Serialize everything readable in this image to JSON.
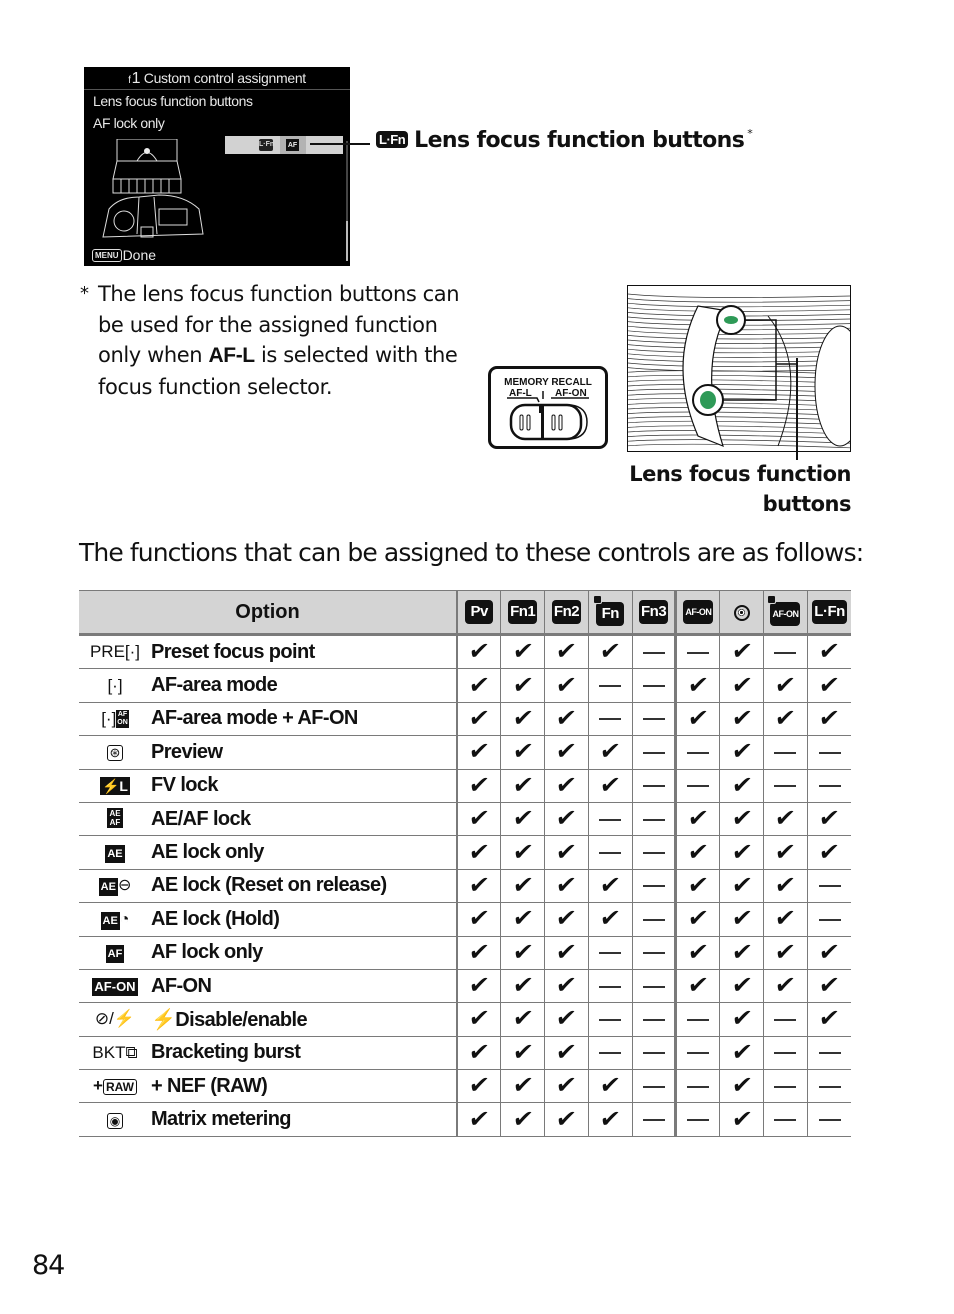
{
  "camera_screen": {
    "menu_code": "f",
    "menu_number": "1",
    "title": "Custom control assignment",
    "selected_control": "Lens focus function buttons",
    "selected_value": "AF lock only",
    "selection_icons": [
      "L·Fn",
      "AF"
    ],
    "done_key": "MENU",
    "done_label": "Done"
  },
  "callout": {
    "badge": "L·Fn",
    "label": "Lens focus function buttons",
    "footnote_marker": "*"
  },
  "footnote": {
    "marker": "*",
    "text_before": "The lens focus function buttons can be used for the assigned function only when ",
    "bold": "AF-L",
    "text_after": " is selected with the focus function selector."
  },
  "selector": {
    "title": "MEMORY RECALL",
    "left_label": "AF-L",
    "right_label": "AF-ON"
  },
  "lens_label": {
    "line1": "Lens focus function",
    "line2": "buttons"
  },
  "intro": "The functions that can be assigned to these controls are as follows:",
  "table": {
    "option_header": "Option",
    "controls": [
      {
        "id": "pv",
        "label": "Pv",
        "style": "badge"
      },
      {
        "id": "fn1",
        "label": "Fn1",
        "style": "badge"
      },
      {
        "id": "fn2",
        "label": "Fn2",
        "style": "badge"
      },
      {
        "id": "vertical-fn",
        "label": "Fn",
        "style": "sub-badge"
      },
      {
        "id": "fn3",
        "label": "Fn3",
        "style": "badge"
      },
      {
        "id": "af-on",
        "label": "AF-ON",
        "style": "small-badge"
      },
      {
        "id": "sub-selector-center",
        "label": "",
        "style": "ring"
      },
      {
        "id": "vertical-af-on",
        "label": "AF-ON",
        "style": "sub-small-badge"
      },
      {
        "id": "l-fn",
        "label": "L·Fn",
        "style": "badge"
      }
    ],
    "rows": [
      {
        "icon": "PRE[·]",
        "icon_name": "preset-focus-point-icon",
        "label": "Preset focus point",
        "values": [
          true,
          true,
          true,
          true,
          false,
          false,
          true,
          false,
          true
        ]
      },
      {
        "icon": "[·]",
        "icon_name": "af-area-mode-icon",
        "label": "AF-area mode",
        "values": [
          true,
          true,
          true,
          false,
          false,
          true,
          true,
          true,
          true
        ]
      },
      {
        "icon": "[·]AF-ON",
        "icon_name": "af-area-mode-af-on-icon",
        "label": "AF-area mode + AF-ON",
        "values": [
          true,
          true,
          true,
          false,
          false,
          true,
          true,
          true,
          true
        ]
      },
      {
        "icon": "preview",
        "icon_name": "preview-aperture-icon",
        "label": "Preview",
        "values": [
          true,
          true,
          true,
          true,
          false,
          false,
          true,
          false,
          false
        ]
      },
      {
        "icon": "⚡L",
        "icon_name": "fv-lock-icon",
        "label": "FV lock",
        "values": [
          true,
          true,
          true,
          true,
          false,
          false,
          true,
          false,
          false
        ]
      },
      {
        "icon": "AE/AF",
        "icon_name": "ae-af-lock-icon",
        "label": "AE/AF lock",
        "values": [
          true,
          true,
          true,
          false,
          false,
          true,
          true,
          true,
          true
        ]
      },
      {
        "icon": "AE",
        "icon_name": "ae-lock-icon",
        "label": "AE lock only",
        "values": [
          true,
          true,
          true,
          false,
          false,
          true,
          true,
          true,
          true
        ]
      },
      {
        "icon": "AE⊖",
        "icon_name": "ae-lock-reset-icon",
        "label": "AE lock (Reset on release)",
        "values": [
          true,
          true,
          true,
          true,
          false,
          true,
          true,
          true,
          false
        ]
      },
      {
        "icon": "AE◔",
        "icon_name": "ae-lock-hold-icon",
        "label": "AE lock (Hold)",
        "values": [
          true,
          true,
          true,
          true,
          false,
          true,
          true,
          true,
          false
        ]
      },
      {
        "icon": "AF",
        "icon_name": "af-lock-icon",
        "label": "AF lock only",
        "values": [
          true,
          true,
          true,
          false,
          false,
          true,
          true,
          true,
          true
        ]
      },
      {
        "icon": "AF-ON",
        "icon_name": "af-on-icon",
        "label": "AF-ON",
        "values": [
          true,
          true,
          true,
          false,
          false,
          true,
          true,
          true,
          true
        ]
      },
      {
        "icon": "⊘/⚡",
        "icon_name": "flash-disable-icon",
        "label": "⚡Disable/enable",
        "values": [
          true,
          true,
          true,
          false,
          false,
          false,
          true,
          false,
          true
        ]
      },
      {
        "icon": "BKT⧉",
        "icon_name": "bracketing-burst-icon",
        "label": "Bracketing burst",
        "values": [
          true,
          true,
          true,
          false,
          false,
          false,
          true,
          false,
          false
        ]
      },
      {
        "icon": "+RAW",
        "icon_name": "nef-raw-icon",
        "label": "+ NEF (RAW)",
        "values": [
          true,
          true,
          true,
          true,
          false,
          false,
          true,
          false,
          false
        ]
      },
      {
        "icon": "[◉]",
        "icon_name": "matrix-metering-icon",
        "label": "Matrix metering",
        "values": [
          true,
          true,
          true,
          true,
          false,
          false,
          true,
          false,
          false
        ]
      }
    ],
    "symbols": {
      "yes": "✔",
      "no": "—"
    }
  },
  "page_number": "84"
}
